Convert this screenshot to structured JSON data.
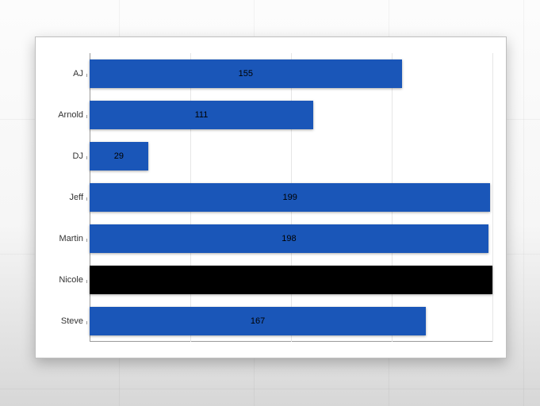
{
  "chart_data": {
    "type": "bar",
    "orientation": "horizontal",
    "categories": [
      "AJ",
      "Arnold",
      "DJ",
      "Jeff",
      "Martin",
      "Nicole",
      "Steve"
    ],
    "values": [
      155,
      111,
      29,
      199,
      198,
      200,
      167
    ],
    "highlight_index": 5,
    "xlim": [
      0,
      200
    ],
    "grid_step": 50,
    "bar_color": "#1a56b8",
    "highlight_color": "#000000",
    "title": "",
    "xlabel": "",
    "ylabel": ""
  }
}
